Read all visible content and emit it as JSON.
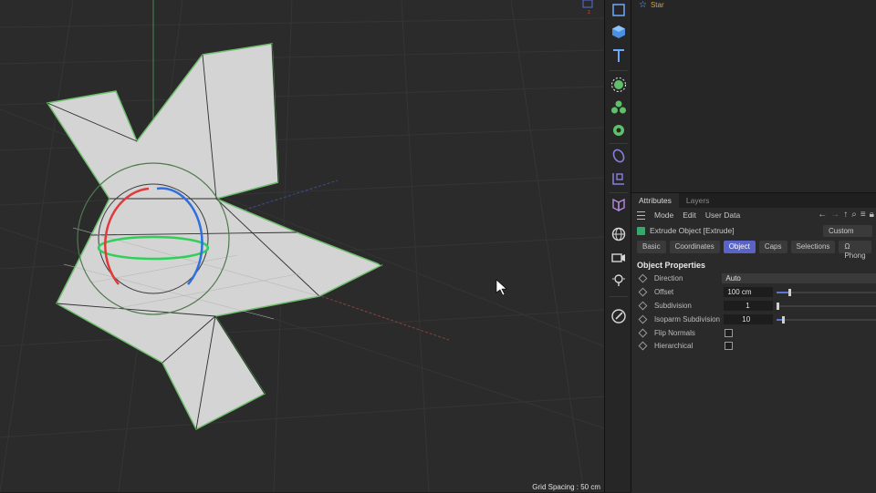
{
  "viewport": {
    "grid_spacing": "Grid Spacing : 50 cm"
  },
  "toolbar": {
    "items": [
      "cube-outline-icon",
      "cube-icon",
      "text-icon",
      "spline-generator-icon",
      "cloner-icon",
      "gear-deformer-icon",
      "field-icon",
      "effector-icon",
      "scene-icon",
      "environment-icon",
      "camera-icon",
      "light-icon",
      "tag-icon"
    ]
  },
  "object_manager": {
    "row_label": "Star"
  },
  "attributes": {
    "tabs": [
      "Attributes",
      "Layers"
    ],
    "menu": [
      "Mode",
      "Edit",
      "User Data"
    ],
    "object_title": "Extrude Object [Extrude]",
    "preset": "Custom",
    "subtabs": [
      "Basic",
      "Coordinates",
      "Object",
      "Caps",
      "Selections",
      "Ω Phong"
    ],
    "active_subtab": "Object",
    "section_title": "Object Properties",
    "properties": {
      "direction": {
        "label": "Direction",
        "value": "Auto"
      },
      "offset": {
        "label": "Offset",
        "value": "100 cm",
        "slider_fraction": 0.13
      },
      "subdivision": {
        "label": "Subdivision",
        "value": "1",
        "slider_fraction": 0.0
      },
      "isoparm": {
        "label": "Isoparm Subdivision",
        "value": "10",
        "slider_fraction": 0.06
      },
      "flip_normals": {
        "label": "Flip Normals",
        "checked": false
      },
      "hierarchical": {
        "label": "Hierarchical",
        "checked": false
      }
    }
  },
  "colors": {
    "accent": "#5a63c8",
    "viewport_bg": "#2b2b2b",
    "mesh_fill": "#d4d4d4",
    "selection_outline": "#6fbf6f"
  }
}
